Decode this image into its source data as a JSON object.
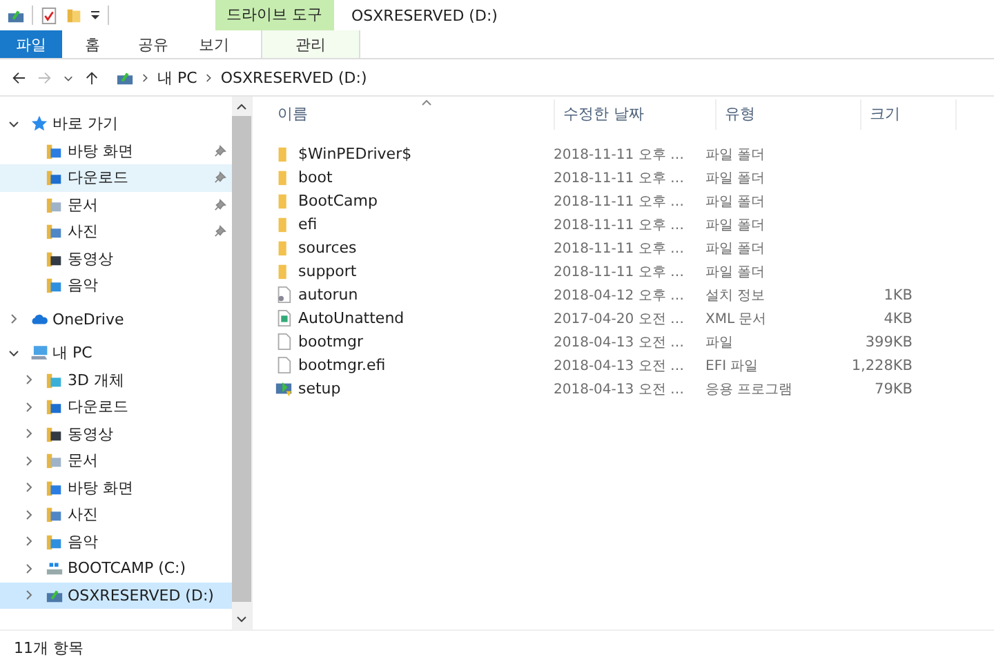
{
  "title_bar": {
    "context_group": "드라이브 도구",
    "title": "OSXRESERVED (D:)"
  },
  "ribbon_tabs": [
    {
      "label": "파일",
      "kind": "file",
      "selected": false
    },
    {
      "label": "홈",
      "kind": "tab",
      "selected": false
    },
    {
      "label": "공유",
      "kind": "tab",
      "selected": false
    },
    {
      "label": "보기",
      "kind": "tab",
      "selected": false
    },
    {
      "label": "관리",
      "kind": "context",
      "selected": false
    }
  ],
  "address_bar": {
    "path": [
      "내 PC",
      "OSXRESERVED (D:)"
    ]
  },
  "nav_tree": [
    {
      "label": "바로 가기",
      "kind": "star",
      "expanded": true,
      "selected": false,
      "highlighted": false,
      "children": [
        {
          "label": "바탕 화면",
          "kind": "desktop",
          "pinned": true,
          "selected": false,
          "highlighted": false
        },
        {
          "label": "다운로드",
          "kind": "download",
          "pinned": true,
          "selected": false,
          "highlighted": true
        },
        {
          "label": "문서",
          "kind": "docs",
          "pinned": true,
          "selected": false,
          "highlighted": false
        },
        {
          "label": "사진",
          "kind": "pics",
          "pinned": true,
          "selected": false,
          "highlighted": false
        },
        {
          "label": "동영상",
          "kind": "video",
          "pinned": false,
          "selected": false,
          "highlighted": false
        },
        {
          "label": "음악",
          "kind": "music",
          "pinned": false,
          "selected": false,
          "highlighted": false
        }
      ]
    },
    {
      "label": "OneDrive",
      "kind": "cloud",
      "expanded": false,
      "selected": false,
      "highlighted": false
    },
    {
      "label": "내 PC",
      "kind": "pc",
      "expanded": true,
      "selected": false,
      "highlighted": false,
      "children": [
        {
          "label": "3D 개체",
          "kind": "obj3d",
          "expanded": false,
          "selected": false,
          "highlighted": false
        },
        {
          "label": "다운로드",
          "kind": "download",
          "expanded": false,
          "selected": false,
          "highlighted": false
        },
        {
          "label": "동영상",
          "kind": "video",
          "expanded": false,
          "selected": false,
          "highlighted": false
        },
        {
          "label": "문서",
          "kind": "docs",
          "expanded": false,
          "selected": false,
          "highlighted": false
        },
        {
          "label": "바탕 화면",
          "kind": "desktop",
          "expanded": false,
          "selected": false,
          "highlighted": false
        },
        {
          "label": "사진",
          "kind": "pics",
          "expanded": false,
          "selected": false,
          "highlighted": false
        },
        {
          "label": "음악",
          "kind": "music",
          "expanded": false,
          "selected": false,
          "highlighted": false
        },
        {
          "label": "BOOTCAMP (C:)",
          "kind": "windrive",
          "expanded": false,
          "selected": false,
          "highlighted": false
        },
        {
          "label": "OSXRESERVED (D:)",
          "kind": "drive",
          "expanded": false,
          "selected": true,
          "highlighted": false
        }
      ]
    }
  ],
  "columns": [
    "이름",
    "수정한 날짜",
    "유형",
    "크기"
  ],
  "files": [
    {
      "kind": "folder",
      "name": "$WinPEDriver$",
      "date": "2018-11-11 오후 …",
      "type": "파일 폴더"
    },
    {
      "kind": "folder",
      "name": "boot",
      "date": "2018-11-11 오후 …",
      "type": "파일 폴더"
    },
    {
      "kind": "folder",
      "name": "BootCamp",
      "date": "2018-11-11 오후 …",
      "type": "파일 폴더"
    },
    {
      "kind": "folder",
      "name": "efi",
      "date": "2018-11-11 오후 …",
      "type": "파일 폴더"
    },
    {
      "kind": "folder",
      "name": "sources",
      "date": "2018-11-11 오후 …",
      "type": "파일 폴더"
    },
    {
      "kind": "folder",
      "name": "support",
      "date": "2018-11-11 오후 …",
      "type": "파일 폴더"
    },
    {
      "kind": "setup-info",
      "name": "autorun",
      "date": "2018-04-12 오후 …",
      "type": "설치 정보",
      "size": "1KB"
    },
    {
      "kind": "xml",
      "name": "AutoUnattend",
      "date": "2017-04-20 오전 …",
      "type": "XML 문서",
      "size": "4KB"
    },
    {
      "kind": "blank",
      "name": "bootmgr",
      "date": "2018-04-13 오전 …",
      "type": "파일",
      "size": "399KB"
    },
    {
      "kind": "blank",
      "name": "bootmgr.efi",
      "date": "2018-04-13 오전 …",
      "type": "EFI 파일",
      "size": "1,228KB"
    },
    {
      "kind": "exe",
      "name": "setup",
      "date": "2018-04-13 오전 …",
      "type": "응용 프로그램",
      "size": "79KB"
    }
  ],
  "status_bar": {
    "count": "11개 항목"
  }
}
